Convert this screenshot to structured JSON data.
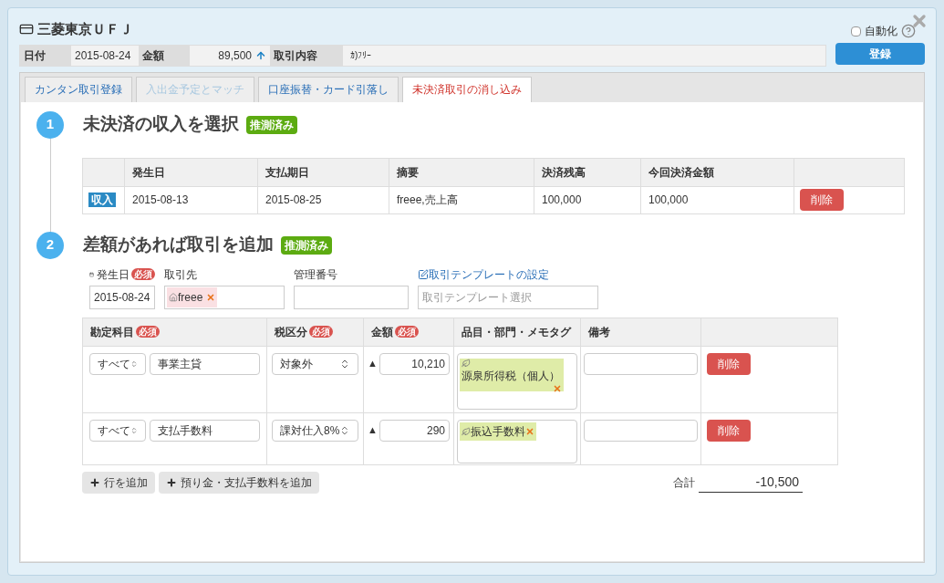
{
  "dialog": {
    "title": "三菱東京ＵＦＪ",
    "auto": {
      "label": "自動化",
      "checked": false
    },
    "summary": {
      "date_label": "日付",
      "date": "2015-08-24",
      "amount_label": "金額",
      "amount": "89,500",
      "description_label": "取引内容",
      "description": "ｶ)ﾌﾘｰ"
    },
    "register_button": "登録"
  },
  "tabs": [
    {
      "label": "カンタン取引登録",
      "selected": false,
      "disabled": false
    },
    {
      "label": "入出金予定とマッチ",
      "selected": false,
      "disabled": true
    },
    {
      "label": "口座振替・カード引落し",
      "selected": false,
      "disabled": false
    },
    {
      "label": "未決済取引の消し込み",
      "selected": true,
      "disabled": false
    }
  ],
  "step1": {
    "number": "1",
    "title": "未決済の収入を選択",
    "badge": "推測済み",
    "columns": [
      "発生日",
      "支払期日",
      "摘要",
      "決済残高",
      "今回決済金額"
    ],
    "rows": [
      {
        "type": "収入",
        "cells": [
          "2015-08-13",
          "2015-08-25",
          "freee,売上高",
          "100,000",
          "100,000"
        ],
        "delete": "削除"
      }
    ]
  },
  "step2": {
    "number": "2",
    "title": "差額があれば取引を追加",
    "badge": "推測済み",
    "date": {
      "label": "発生日",
      "required": "必須",
      "value": "2015-08-24"
    },
    "partner": {
      "label": "取引先",
      "tag": "freee"
    },
    "management_number": {
      "label": "管理番号"
    },
    "template": {
      "link": "取引テンプレートの設定",
      "placeholder": "取引テンプレート選択"
    },
    "columns": [
      {
        "label": "勘定科目",
        "required": "必須"
      },
      {
        "label": "税区分",
        "required": "必須"
      },
      {
        "label": "金額",
        "required": "必須"
      },
      {
        "label": "品目・部門・メモタグ"
      },
      {
        "label": "備考"
      }
    ],
    "rows": [
      {
        "filter": "すべて",
        "account": "事業主貸",
        "tax": "対象外",
        "sign": "▲",
        "amount": "10,210",
        "tags": [
          "源泉所得税（個人）"
        ],
        "delete": "削除"
      },
      {
        "filter": "すべて",
        "account": "支払手数料",
        "tax": "課対仕入8%",
        "sign": "▲",
        "amount": "290",
        "tags": [
          "振込手数料"
        ],
        "delete": "削除"
      }
    ],
    "add_row_button": "行を追加",
    "add_fee_button": "預り金・支払手数料を追加",
    "total_label": "合計",
    "total": "-10,500"
  }
}
